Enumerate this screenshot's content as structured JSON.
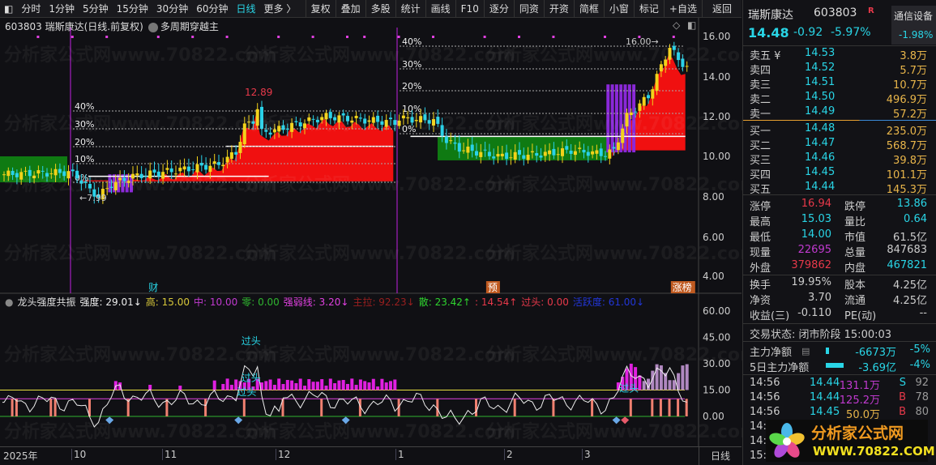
{
  "toolbar": {
    "periods": [
      "分时",
      "1分钟",
      "5分钟",
      "15分钟",
      "30分钟",
      "60分钟",
      "日线",
      "更多 〉"
    ],
    "active": "日线",
    "buttons": [
      "复权",
      "叠加",
      "多股",
      "统计",
      "画线",
      "F10",
      "逐分",
      "同资",
      "开资",
      "简框",
      "小窗",
      "标记",
      "+自选",
      "返回"
    ]
  },
  "chart": {
    "title": "603803 瑞斯康达(日线.前复权)",
    "indicator": "多周期穿越主",
    "price_ticks": [
      "16.00",
      "14.00",
      "12.00",
      "10.00",
      "8.00",
      "6.00",
      "4.00"
    ],
    "high_label": "12.89",
    "low_label": "←7.99",
    "top_label": "16.00→",
    "pct_labels": [
      "40%",
      "30%",
      "20%",
      "10%",
      "0%"
    ],
    "events": [
      {
        "label": "财",
        "index": 34
      },
      {
        "label": "预",
        "index": 113
      },
      {
        "label": "涨榜",
        "index": 156
      }
    ],
    "closes_anchor": [
      [
        0,
        9.1
      ],
      [
        15,
        9.2
      ],
      [
        17,
        9.0
      ],
      [
        20,
        8.3
      ],
      [
        22,
        8.0
      ],
      [
        25,
        8.6
      ],
      [
        30,
        9.0
      ],
      [
        40,
        9.3
      ],
      [
        50,
        9.6
      ],
      [
        54,
        10.2
      ],
      [
        56,
        11.5
      ],
      [
        58,
        11.8
      ],
      [
        59,
        12.4
      ],
      [
        60,
        11.2
      ],
      [
        63,
        11.3
      ],
      [
        68,
        11.6
      ],
      [
        75,
        12.0
      ],
      [
        85,
        11.8
      ],
      [
        91,
        11.7
      ],
      [
        92,
        11.9
      ],
      [
        100,
        11.8
      ],
      [
        103,
        10.8
      ],
      [
        106,
        10.4
      ],
      [
        115,
        10.0
      ],
      [
        125,
        10.1
      ],
      [
        132,
        10.3
      ],
      [
        140,
        10.1
      ],
      [
        142,
        10.3
      ],
      [
        145,
        12.0
      ],
      [
        150,
        13.0
      ],
      [
        153,
        14.5
      ],
      [
        155,
        15.5
      ],
      [
        157,
        14.8
      ],
      [
        159,
        14.5
      ]
    ],
    "ylim": [
      3.7,
      16.6
    ]
  },
  "indicator": {
    "name": "龙头强度共振",
    "items": [
      {
        "text": "强度: 29.01↓",
        "color": "#eeeeee"
      },
      {
        "text": "高: 15.00",
        "color": "#d8c83a"
      },
      {
        "text": "中: 10.00",
        "color": "#c13ad0"
      },
      {
        "text": "零: 0.00",
        "color": "#2fb52f"
      },
      {
        "text": "强弱线: 3.20↓",
        "color": "#e040e0"
      },
      {
        "text": "主拉: 92.23↓",
        "color": "#9a1f1f"
      },
      {
        "text": "散: 23.42↑",
        "color": "#2fd52f"
      },
      {
        "text": ": 14.54↑",
        "color": "#e8394a"
      },
      {
        "text": "过头: 0.00",
        "color": "#e8394a"
      },
      {
        "text": "活跃度: 61.00↓",
        "color": "#2236d8"
      }
    ],
    "ticks": [
      "60.00",
      "45.00",
      "30.00",
      "15.00",
      "0.00"
    ],
    "labels": [
      "过头",
      "过头",
      "过头",
      "过头"
    ]
  },
  "xaxis": {
    "labels": [
      "2025年",
      "10",
      "11",
      "12",
      "1",
      "2",
      "3"
    ],
    "period": "日线"
  },
  "quote": {
    "name": "瑞斯康达",
    "code": "603803",
    "flag": "R",
    "sector": "通信设备",
    "sector_pct": "-1.98%",
    "price": "14.48",
    "change": "-0.92",
    "pct": "-5.97%",
    "asks": [
      [
        "卖五 ¥",
        "14.53",
        "3.8万"
      ],
      [
        "卖四",
        "14.52",
        "5.7万"
      ],
      [
        "卖三",
        "14.51",
        "10.7万"
      ],
      [
        "卖二",
        "14.50",
        "496.9万"
      ],
      [
        "卖一",
        "14.49",
        "57.2万"
      ]
    ],
    "bids": [
      [
        "买一",
        "14.48",
        "235.0万"
      ],
      [
        "买二",
        "14.47",
        "568.7万"
      ],
      [
        "买三",
        "14.46",
        "39.8万"
      ],
      [
        "买四",
        "14.45",
        "101.1万"
      ],
      [
        "买五",
        "14.44",
        "145.3万"
      ]
    ],
    "stats": [
      [
        "涨停",
        "16.94",
        "rd",
        "跌停",
        "13.86",
        "cy"
      ],
      [
        "最高",
        "15.03",
        "cy",
        "量比",
        "0.64",
        "cy"
      ],
      [
        "最低",
        "14.00",
        "cy",
        "市值",
        "61.5亿",
        "wh"
      ],
      [
        "现量",
        "22695",
        "mg",
        "总量",
        "847683",
        "wh"
      ],
      [
        "外盘",
        "379862",
        "rd",
        "内盘",
        "467821",
        "cy"
      ]
    ],
    "stats2": [
      [
        "换手",
        "19.95%",
        "股本",
        "4.25亿"
      ],
      [
        "净资",
        "3.70",
        "流通",
        "4.25亿"
      ],
      [
        "收益(三)",
        "-0.110",
        "PE(动)",
        "--"
      ]
    ],
    "status": "交易状态: 闭市阶段 15:00:03",
    "flows": [
      [
        "主力净额",
        "-6673万",
        "-5%"
      ],
      [
        "5日主力净额",
        "-3.69亿",
        "-4%"
      ]
    ],
    "ticks": [
      [
        "14:56",
        "14.44",
        "131.1万",
        "S",
        "92",
        "mg"
      ],
      [
        "14:56",
        "14.44",
        "125.2万",
        "B",
        "78",
        "mg"
      ],
      [
        "14:56",
        "14.45",
        "50.0万",
        "B",
        "80",
        "yl"
      ],
      [
        "14:56",
        "",
        "",
        "",
        "",
        ""
      ],
      [
        "14:5",
        "",
        "",
        "",
        "",
        ""
      ],
      [
        "15:0",
        "",
        "",
        "",
        "",
        ""
      ]
    ]
  },
  "watermark": {
    "text": "分析家公式网www.70822.com",
    "logo_title": "分析家公式网",
    "logo_url": "WWW.70822.COM"
  }
}
